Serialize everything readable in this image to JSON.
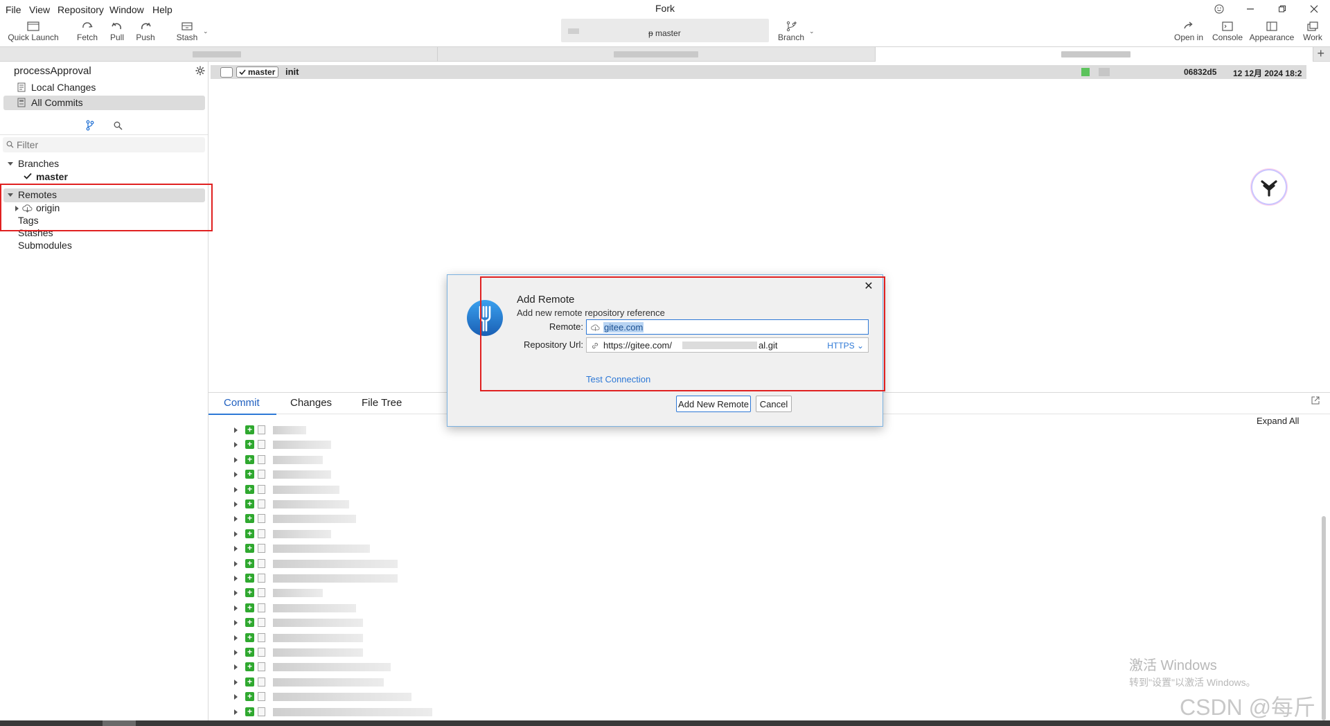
{
  "menu": {
    "items": [
      "File",
      "View",
      "Repository",
      "Window",
      "Help"
    ]
  },
  "app_title": "Fork",
  "toolbar": {
    "quick_launch": "Quick Launch",
    "fetch": "Fetch",
    "pull": "Pull",
    "push": "Push",
    "stash": "Stash",
    "branch": "Branch",
    "current_branch": "master",
    "open_in": "Open in",
    "console": "Console",
    "appearance": "Appearance",
    "work": "Work"
  },
  "sidebar": {
    "repo_name": "processApproval",
    "nav": [
      "Local Changes",
      "All Commits"
    ],
    "filter_placeholder": "Filter",
    "tree": {
      "branches": "Branches",
      "master": "master",
      "remotes": "Remotes",
      "origin": "origin",
      "tags": "Tags",
      "stashes": "Stashes",
      "submodules": "Submodules"
    }
  },
  "commit": {
    "branch": "master",
    "message": "init",
    "sha": "06832d5",
    "date": "12 12月 2024 18:2"
  },
  "bottom": {
    "tabs": [
      "Commit",
      "Changes",
      "File Tree"
    ],
    "expand_all": "Expand All"
  },
  "dialog": {
    "title": "Add Remote",
    "subtitle": "Add new remote repository reference",
    "remote_label": "Remote:",
    "remote_value": "gitee.com",
    "url_label": "Repository Url:",
    "url_prefix": "https://gitee.com/",
    "url_suffix": "al.git",
    "protocol": "HTTPS",
    "test_connection": "Test Connection",
    "add_button": "Add New Remote",
    "cancel_button": "Cancel"
  },
  "watermark": {
    "line1": "激活 Windows",
    "line2": "转到\"设置\"以激活 Windows。",
    "csdn": "CSDN @每斤"
  },
  "colors": {
    "accent": "#2d78d6",
    "annotation_red": "#e02020",
    "added_green": "#2fa82f",
    "selection": "#dcdcdc"
  }
}
